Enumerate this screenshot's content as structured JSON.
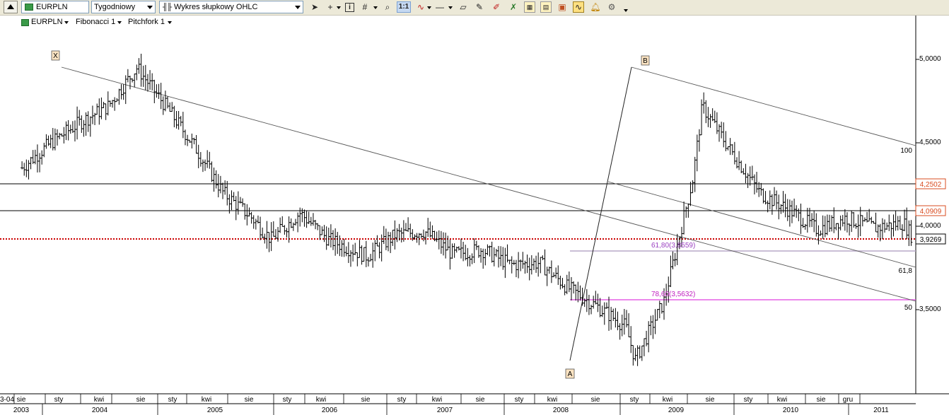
{
  "toolbar": {
    "symbol": "EURPLN",
    "interval": "Tygodniowy",
    "chart_type": "Wykres słupkowy OHLC",
    "zoom_label": "1:1",
    "icons": [
      "panel-toggle-icon",
      "symbol-icon",
      "cursor-icon",
      "crosshair-icon",
      "info-icon",
      "grid-icon",
      "zoom-icon",
      "one-to-one-icon",
      "indicator-icon",
      "line-icon",
      "eraser-icon",
      "drawing-icon",
      "color-icon",
      "template-icon",
      "compare-icon",
      "layout-icon",
      "alert-icon",
      "signal-icon",
      "bell-icon",
      "settings-icon"
    ]
  },
  "subbar": {
    "symbol": "EURPLN",
    "fibonacci": "Fibonacci 1",
    "pitchfork": "Pitchfork 1"
  },
  "labels": {
    "X": "X",
    "A": "A",
    "B": "B"
  },
  "fib_labels": [
    "61,80(3,8559)",
    "78,60(3,5632)"
  ],
  "pitchfork_labels": [
    "100",
    "61,8",
    "50"
  ],
  "price_axis": {
    "ticks": [
      "5,0000",
      "4,5000",
      "4,0000",
      "3,5000"
    ],
    "markers": [
      {
        "text": "4,2502",
        "color": "#d94c20"
      },
      {
        "text": "4,0909",
        "color": "#d94c20"
      },
      {
        "text": "3,9269",
        "color": "#000000"
      }
    ]
  },
  "time_axis": {
    "months": [
      "sie",
      "sty",
      "kwi",
      "sie",
      "sty",
      "kwi",
      "sie",
      "sty",
      "kwi",
      "sie",
      "sty",
      "kwi",
      "sie",
      "sty",
      "kwi",
      "sie",
      "sty",
      "kwi",
      "sie",
      "sty",
      "kwi",
      "sie",
      "gru"
    ],
    "first_partial": "3-04",
    "years": [
      "2003",
      "2004",
      "2005",
      "2006",
      "2007",
      "2008",
      "2009",
      "2010",
      "2011"
    ]
  },
  "chart_data": {
    "type": "ohlc",
    "symbol": "EURPLN",
    "interval": "Tygodniowy",
    "ylim": [
      3.08,
      5.3
    ],
    "y_ticks": [
      5.0,
      4.5,
      4.0,
      3.5
    ],
    "horizontal_levels": [
      4.2502,
      4.0909
    ],
    "last_price": 3.9269,
    "fib_levels": [
      {
        "ratio": 61.8,
        "price": 3.8559
      },
      {
        "ratio": 78.6,
        "price": 3.5632
      }
    ],
    "pivots": [
      {
        "label": "X",
        "date": "2004-03",
        "price": 4.95
      },
      {
        "label": "A",
        "date": "2008-07",
        "price": 3.2
      },
      {
        "label": "B",
        "date": "2009-02",
        "price": 4.94
      }
    ],
    "price_path": [
      [
        "2003-03",
        4.35
      ],
      [
        "2003-06",
        4.5
      ],
      [
        "2003-09",
        4.62
      ],
      [
        "2003-12",
        4.72
      ],
      [
        "2004-03",
        4.95
      ],
      [
        "2004-06",
        4.72
      ],
      [
        "2004-09",
        4.48
      ],
      [
        "2004-12",
        4.2
      ],
      [
        "2005-03",
        4.05
      ],
      [
        "2005-05",
        3.92
      ],
      [
        "2005-08",
        4.08
      ],
      [
        "2005-11",
        3.92
      ],
      [
        "2006-03",
        3.82
      ],
      [
        "2006-06",
        3.95
      ],
      [
        "2006-09",
        3.97
      ],
      [
        "2006-12",
        3.83
      ],
      [
        "2007-03",
        3.86
      ],
      [
        "2007-06",
        3.77
      ],
      [
        "2007-09",
        3.78
      ],
      [
        "2007-12",
        3.63
      ],
      [
        "2008-03",
        3.52
      ],
      [
        "2008-06",
        3.4
      ],
      [
        "2008-07",
        3.2
      ],
      [
        "2008-10",
        3.55
      ],
      [
        "2009-01",
        4.28
      ],
      [
        "2009-02",
        4.72
      ],
      [
        "2009-05",
        4.45
      ],
      [
        "2009-08",
        4.2
      ],
      [
        "2009-11",
        4.1
      ],
      [
        "2010-02",
        3.98
      ],
      [
        "2010-05",
        4.05
      ],
      [
        "2010-08",
        3.99
      ],
      [
        "2010-11",
        4.02
      ],
      [
        "2010-12",
        3.93
      ]
    ]
  }
}
